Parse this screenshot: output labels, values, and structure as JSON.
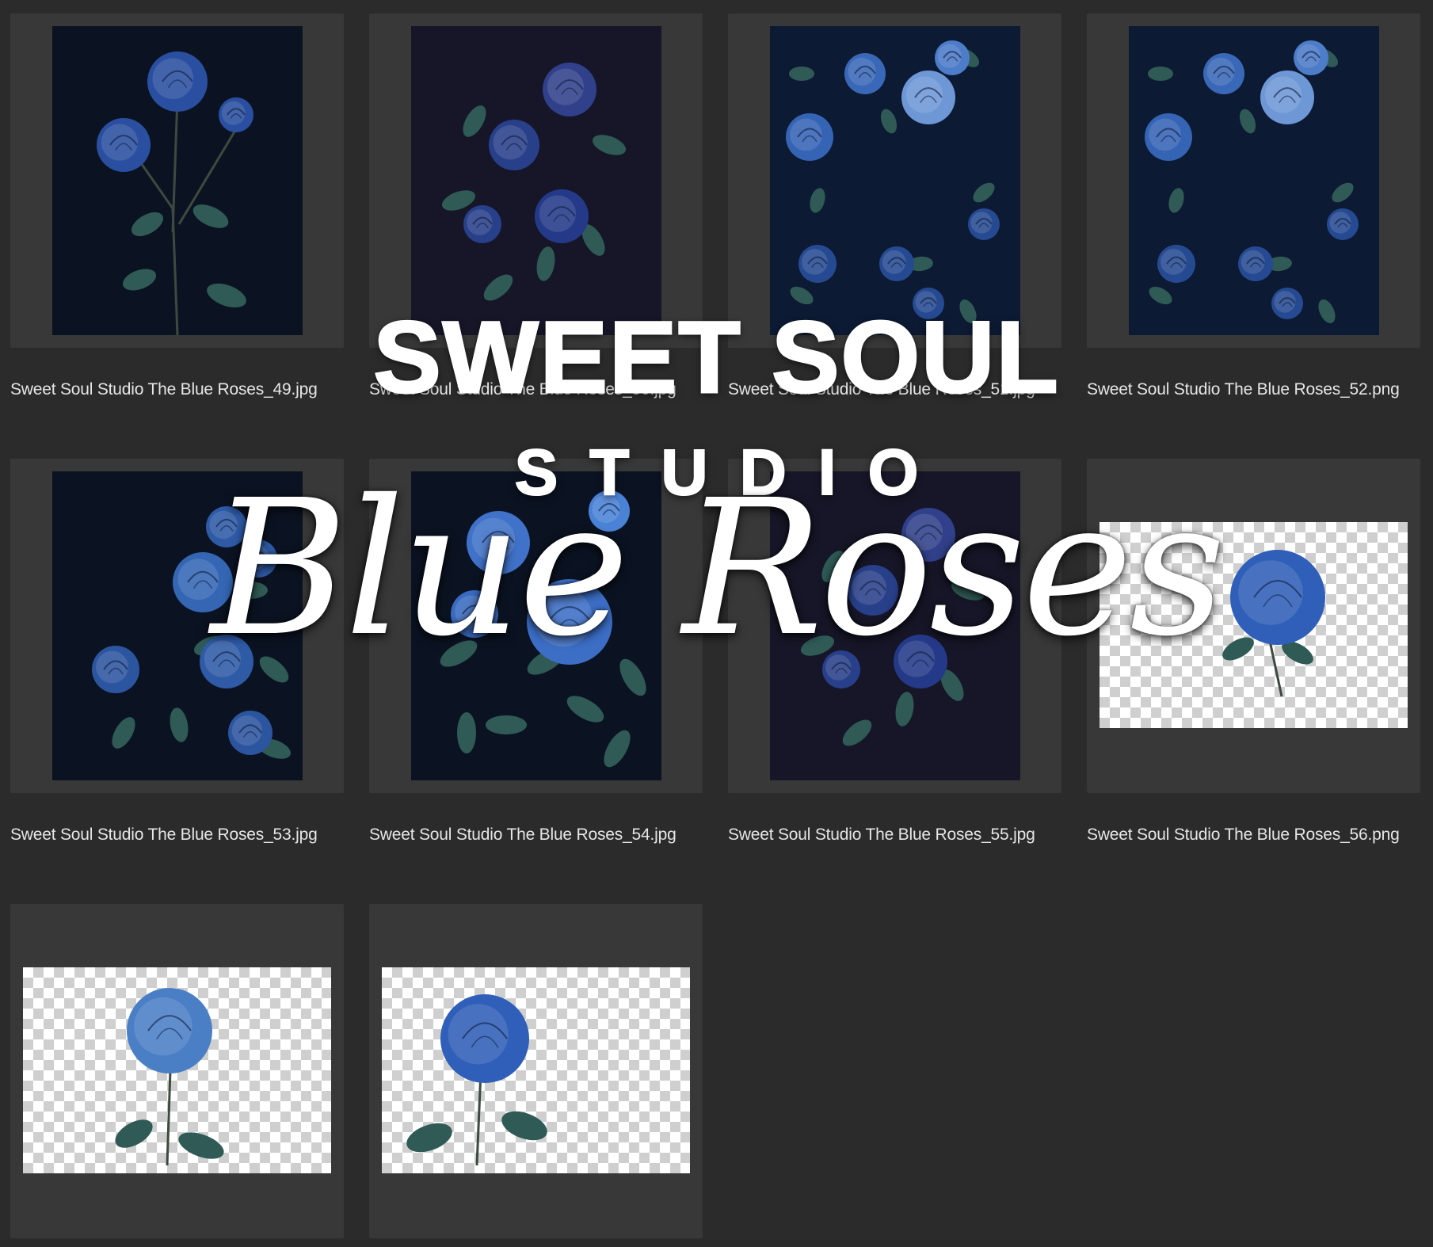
{
  "files": [
    {
      "name": "Sweet Soul Studio The Blue Roses_49.jpg",
      "kind": "portrait",
      "scene": "single-stem"
    },
    {
      "name": "Sweet Soul Studio The Blue Roses_50.jpg",
      "kind": "portrait",
      "scene": "bush-dark"
    },
    {
      "name": "Sweet Soul Studio The Blue Roses_51.jpg",
      "kind": "portrait",
      "scene": "pattern"
    },
    {
      "name": "Sweet Soul Studio The Blue Roses_52.png",
      "kind": "portrait",
      "scene": "pattern"
    },
    {
      "name": "Sweet Soul Studio The Blue Roses_53.jpg",
      "kind": "portrait",
      "scene": "cluster-right"
    },
    {
      "name": "Sweet Soul Studio The Blue Roses_54.jpg",
      "kind": "portrait",
      "scene": "bloom-large"
    },
    {
      "name": "Sweet Soul Studio The Blue Roses_55.jpg",
      "kind": "portrait",
      "scene": "bush-dark"
    },
    {
      "name": "Sweet Soul Studio The Blue Roses_56.png",
      "kind": "transparent",
      "scene": "single-rose"
    },
    {
      "name": "",
      "kind": "transparent",
      "scene": "single-rose"
    },
    {
      "name": "",
      "kind": "transparent",
      "scene": "single-rose"
    }
  ],
  "overlay": {
    "title": "SWEET SOUL",
    "subtitle": "STUDIO",
    "script": "Blue Roses"
  },
  "colors": {
    "background": "#2b2b2b",
    "tile": "#383838",
    "rose": "#2f5fb8",
    "leaf": "#2f5a55",
    "text": "#e6e6e6"
  }
}
